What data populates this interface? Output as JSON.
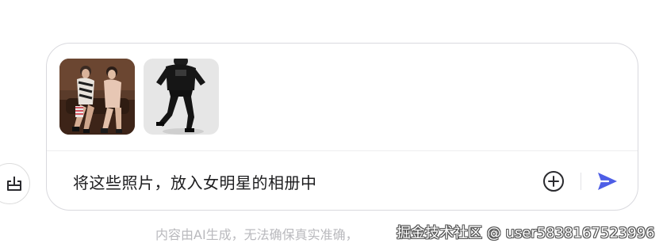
{
  "composer": {
    "prompt_text": "将这些照片，放入女明星的相册中",
    "attachments": [
      {
        "name": "photo-two-women"
      },
      {
        "name": "photo-man-in-black"
      }
    ]
  },
  "footer": {
    "disclaimer": "内容由AI生成，无法确保真实准确，",
    "watermark": "掘金技术社区 @ user5838167523996"
  },
  "colors": {
    "send_accent": "#4e5ee6",
    "icon_dark": "#2a2a2e",
    "border": "#d9d9de",
    "disclaimer_text": "#b9b9bd"
  },
  "icons": {
    "side": "export-icon",
    "add": "plus-circle-icon",
    "send": "send-icon"
  }
}
